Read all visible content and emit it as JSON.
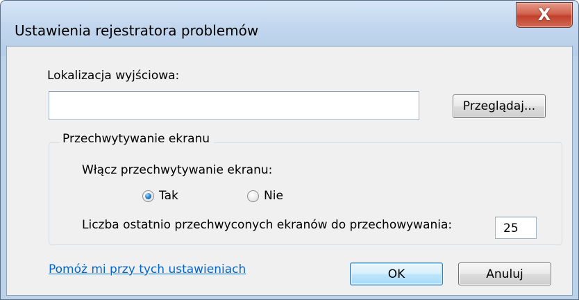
{
  "window": {
    "title": "Ustawienia rejestratora problemów",
    "close_label": "X"
  },
  "output": {
    "label": "Lokalizacja wyjściowa:",
    "value": "",
    "browse_label": "Przeglądaj..."
  },
  "screen_capture": {
    "group_title": "Przechwytywanie ekranu",
    "enable_label": "Włącz przechwytywanie ekranu:",
    "options": [
      {
        "label": "Tak",
        "checked": true
      },
      {
        "label": "Nie",
        "checked": false
      }
    ],
    "count_label": "Liczba ostatnio przechwyconych ekranów do przechowywania:",
    "count_value": "25"
  },
  "footer": {
    "help_link": "Pomóż mi przy tych ustawieniach",
    "ok_label": "OK",
    "cancel_label": "Anuluj"
  }
}
